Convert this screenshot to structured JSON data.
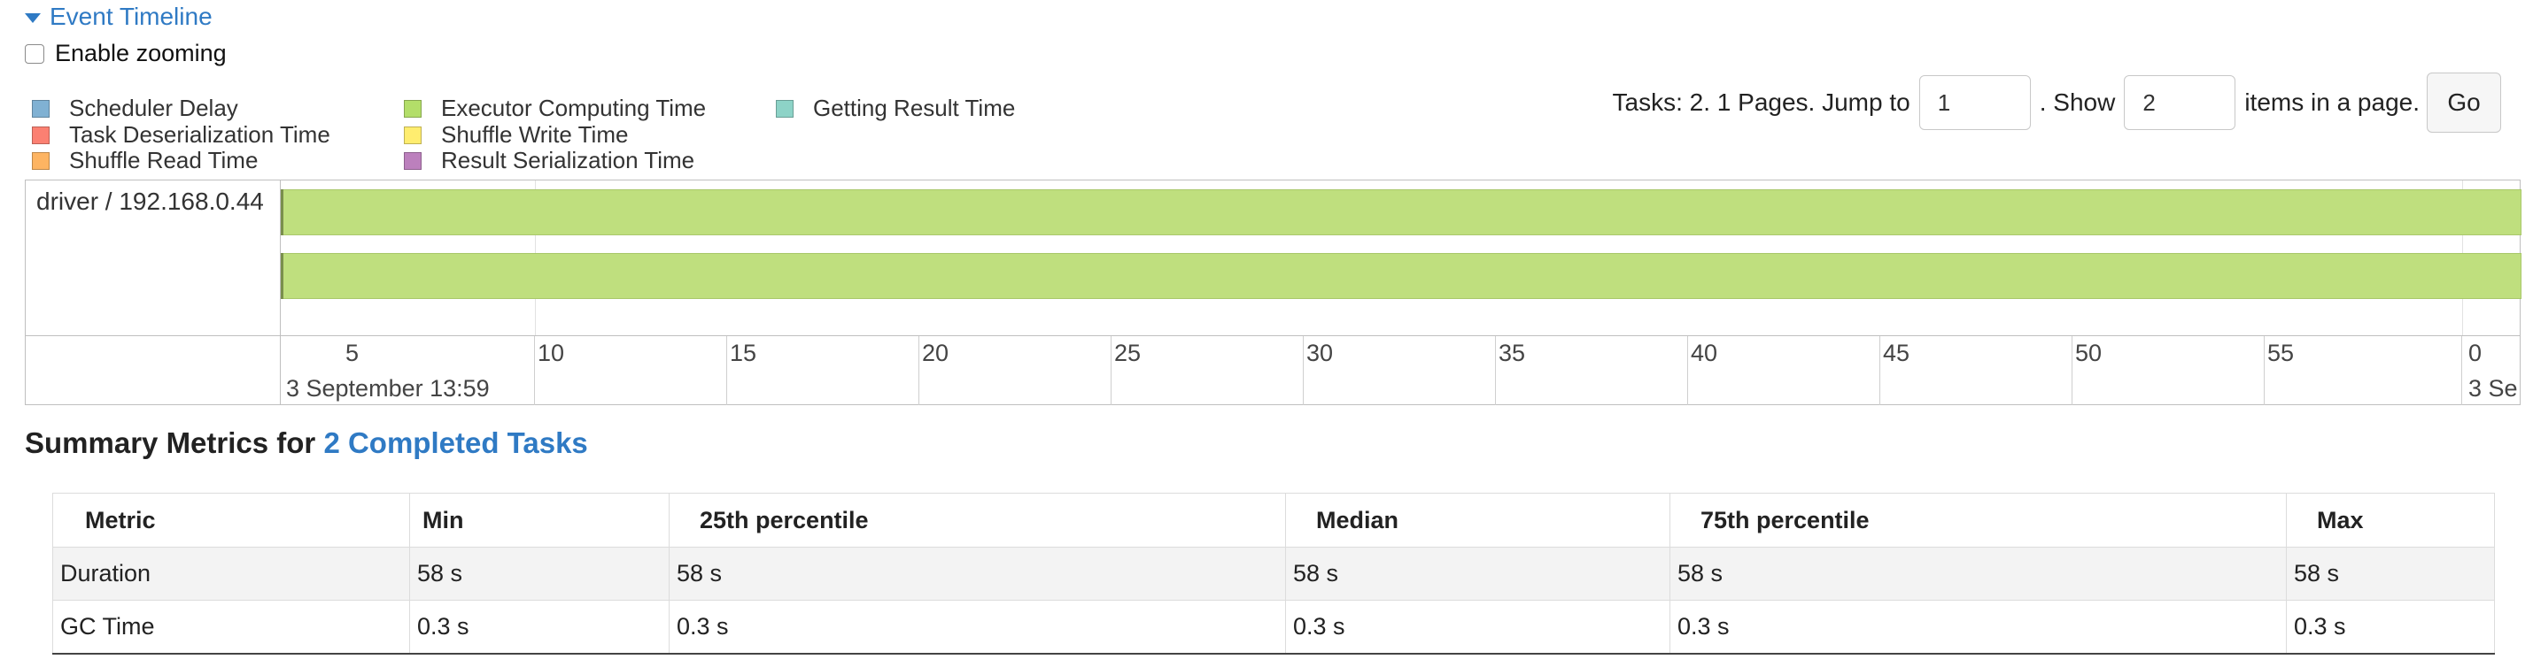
{
  "timeline": {
    "toggle_label": "Event Timeline",
    "enable_zooming_label": "Enable zooming",
    "legend": [
      {
        "label": "Scheduler Delay",
        "color": "#80b1d3"
      },
      {
        "label": "Task Deserialization Time",
        "color": "#fb8072"
      },
      {
        "label": "Shuffle Read Time",
        "color": "#fdb462"
      },
      {
        "label": "Executor Computing Time",
        "color": "#b3de69"
      },
      {
        "label": "Shuffle Write Time",
        "color": "#ffed6f"
      },
      {
        "label": "Result Serialization Time",
        "color": "#bc80bd"
      },
      {
        "label": "Getting Result Time",
        "color": "#8dd3c7"
      }
    ],
    "group_label": "driver / 192.168.0.44",
    "axis_ticks": [
      "5",
      "10",
      "15",
      "20",
      "25",
      "30",
      "35",
      "40",
      "45",
      "50",
      "55",
      "0"
    ],
    "date_labels": [
      "3 September 13:59",
      "3 Se"
    ]
  },
  "pager": {
    "prefix": "Tasks: 2. 1 Pages. Jump to",
    "page_value": "1",
    "show_label": ". Show",
    "items_value": "2",
    "suffix": "items in a page.",
    "go_label": "Go"
  },
  "summary": {
    "title_prefix": "Summary Metrics for",
    "title_link": "2 Completed Tasks",
    "headers": [
      "Metric",
      "Min",
      "25th percentile",
      "Median",
      "75th percentile",
      "Max"
    ],
    "rows": [
      [
        "Duration",
        "58 s",
        "58 s",
        "58 s",
        "58 s",
        "58 s"
      ],
      [
        "GC Time",
        "0.3 s",
        "0.3 s",
        "0.3 s",
        "0.3 s",
        "0.3 s"
      ]
    ]
  }
}
